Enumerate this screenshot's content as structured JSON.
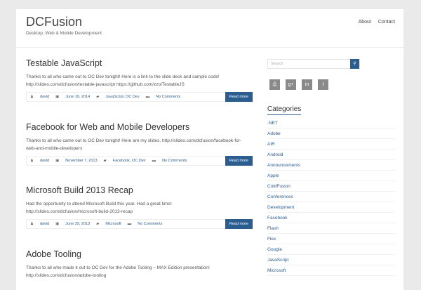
{
  "site": {
    "title": "DCFusion",
    "tagline": "Desktop, Web & Mobile Development"
  },
  "nav": [
    "About",
    "Contact"
  ],
  "posts": [
    {
      "title": "Testable JavaScript",
      "lines": [
        "Thanks to all who came out to OC Dev tonight! Here is a link to the slide deck and sample code!",
        "http://slides.com/dcfusion/testable-javascript https://github.com/zzo/TestableJS"
      ],
      "author": "david",
      "date": "June 19, 2014",
      "categories": "JavaScript, OC Dev",
      "comments": "No Comments",
      "read_more": "Read more"
    },
    {
      "title": "Facebook for Web and Mobile Developers",
      "lines": [
        "Thanks to all who came out to OC Dev tonight! Here are my slides. http://slides.com/dcfusion/facebook-for-",
        "web-and-mobile-developers"
      ],
      "author": "david",
      "date": "November 7, 2013",
      "categories": "Facebook, OC Dev",
      "comments": "No Comments",
      "read_more": "Read more"
    },
    {
      "title": "Microsoft Build 2013 Recap",
      "lines": [
        "Had the opportunity to attend Microsoft Build this year. Had a great time!",
        "http://slides.com/dcfusion/microsoft-build-2013-recap"
      ],
      "author": "david",
      "date": "June 29, 2013",
      "categories": "Microsoft",
      "comments": "No Comments",
      "read_more": "Read more"
    },
    {
      "title": "Adobe Tooling",
      "lines": [
        "Thanks to all who made it out to OC Dev for the Adobe Tooling – MAX Edition presentation!",
        "http://slides.com/dcfusion/adobe-tooling"
      ]
    }
  ],
  "search": {
    "placeholder": "Search"
  },
  "categories_title": "Categories",
  "categories": [
    ".NET",
    "Adobe",
    "AIR",
    "Android",
    "Announcements",
    "Apple",
    "ColdFusion",
    "Conferences",
    "Development",
    "Facebook",
    "Flash",
    "Flex",
    "Google",
    "JavaScript",
    "Microsoft"
  ]
}
